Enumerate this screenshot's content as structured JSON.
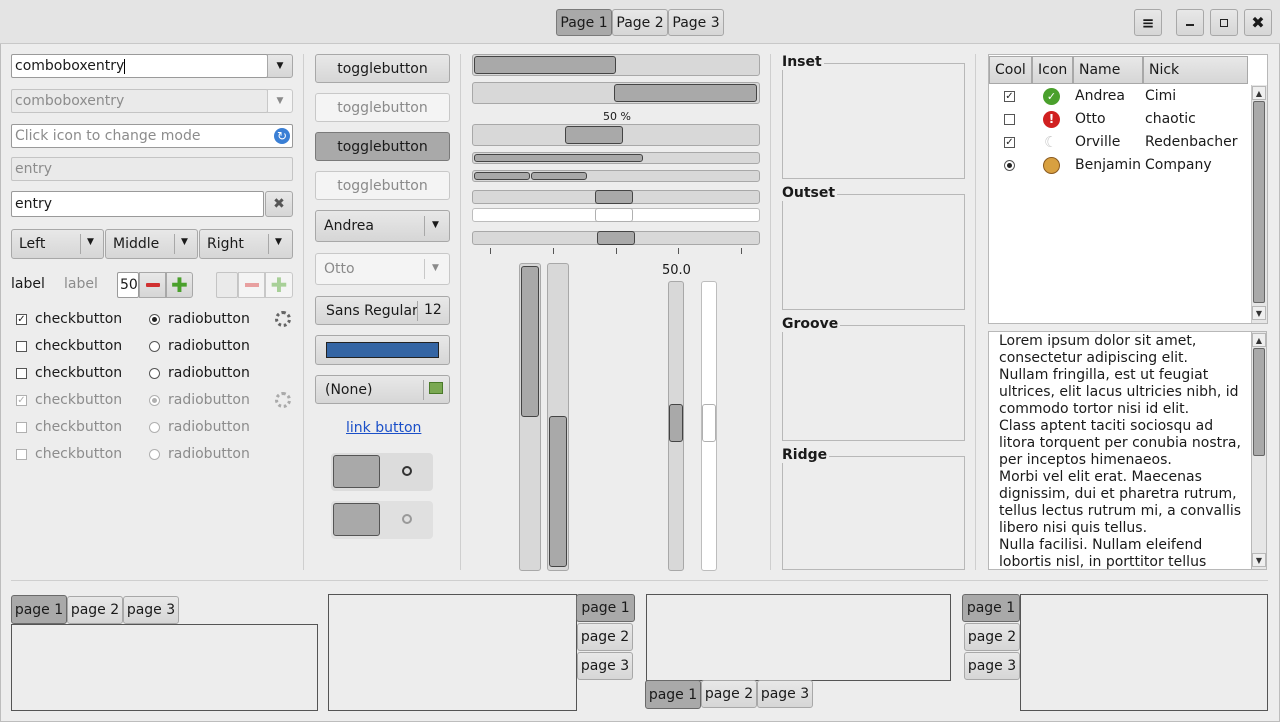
{
  "header": {
    "tabs": [
      "Page 1",
      "Page 2",
      "Page 3"
    ],
    "active_tab": 0
  },
  "col1": {
    "combo1_value": "comboboxentry",
    "combo2_value": "comboboxentry",
    "icon_entry_placeholder": "Click icon to change mode",
    "entry_disabled": "entry",
    "entry_value": "entry",
    "segmented": [
      "Left",
      "Middle",
      "Right"
    ],
    "label1": "label",
    "label2": "label",
    "spin_value": "50",
    "checks": [
      {
        "label": "checkbutton",
        "checked": true
      },
      {
        "label": "checkbutton",
        "checked": false
      },
      {
        "label": "checkbutton",
        "checked": false
      },
      {
        "label": "checkbutton",
        "checked": true
      },
      {
        "label": "checkbutton",
        "checked": false
      },
      {
        "label": "checkbutton",
        "checked": false
      }
    ],
    "radios": [
      {
        "label": "radiobutton",
        "checked": true
      },
      {
        "label": "radiobutton",
        "checked": false
      },
      {
        "label": "radiobutton",
        "checked": false
      },
      {
        "label": "radiobutton",
        "checked": true
      },
      {
        "label": "radiobutton",
        "checked": false
      },
      {
        "label": "radiobutton",
        "checked": false
      }
    ]
  },
  "col2": {
    "toggles": [
      "togglebutton",
      "togglebutton",
      "togglebutton",
      "togglebutton"
    ],
    "combo_andrea": "Andrea",
    "combo_otto": "Otto",
    "font_name": "Sans Regular",
    "font_size": "12",
    "color_swatch": "#3465a4",
    "file_chooser": "(None)",
    "link": "link button"
  },
  "col3": {
    "progress_label": "50 %",
    "scale_value_top": "50.0",
    "progress1": 0.5,
    "progress2": 0.5
  },
  "frames": [
    "Inset",
    "Outset",
    "Groove",
    "Ridge"
  ],
  "tree": {
    "columns": [
      "Cool",
      "Icon",
      "Name",
      "Nick"
    ],
    "rows": [
      {
        "cool": "check-on",
        "icon": "ok-icon",
        "name": "Andrea",
        "nick": "Cimi"
      },
      {
        "cool": "check-off",
        "icon": "error-icon",
        "name": "Otto",
        "nick": "chaotic"
      },
      {
        "cool": "check-on",
        "icon": "moon-icon",
        "name": "Orville",
        "nick": "Redenbacher"
      },
      {
        "cool": "radio-on",
        "icon": "monkey-icon",
        "name": "Benjamin",
        "nick": "Company"
      }
    ]
  },
  "textview": {
    "lines": [
      "Lorem ipsum dolor sit amet,",
      "consectetur adipiscing elit.",
      "Nullam fringilla, est ut feugiat",
      "ultrices, elit lacus ultricies nibh, id",
      "commodo tortor nisi id elit.",
      "Class aptent taciti sociosqu ad",
      "litora torquent per conubia nostra,",
      "per inceptos himenaeos.",
      "Morbi vel elit erat. Maecenas",
      "dignissim, dui et pharetra rutrum,",
      "tellus lectus rutrum mi, a convallis",
      "libero nisi quis tellus.",
      "Nulla facilisi. Nullam eleifend",
      "lobortis nisl, in porttitor tellus"
    ]
  },
  "notebooks": {
    "nb1": [
      "page 1",
      "page 2",
      "page 3"
    ],
    "nb2": [
      "page 1",
      "page 2",
      "page 3"
    ],
    "nb3": [
      "page 1",
      "page 2",
      "page 3"
    ],
    "nb4": [
      "page 1",
      "page 2",
      "page 3"
    ]
  }
}
